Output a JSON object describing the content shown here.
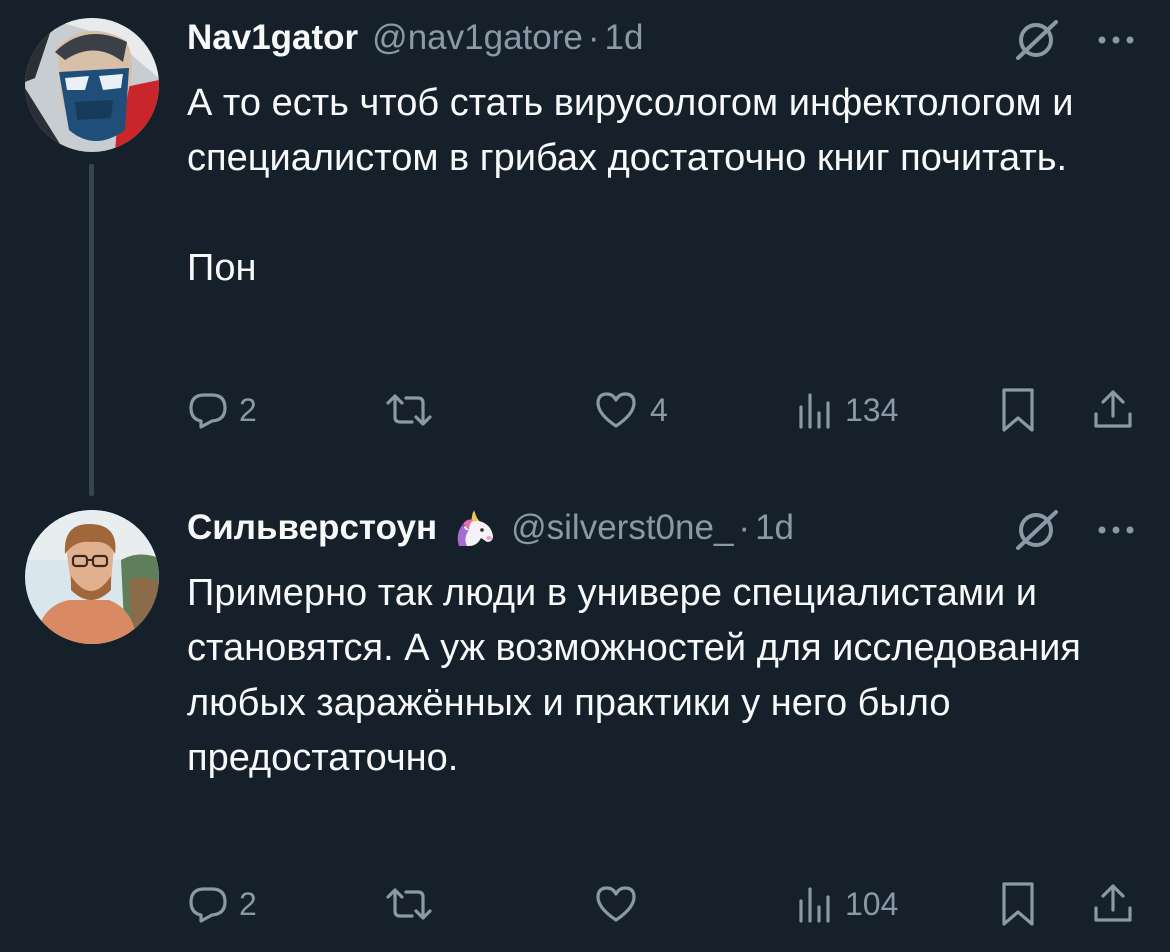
{
  "tweets": [
    {
      "display_name": "Nav1gator",
      "handle": "@nav1gatore",
      "separator": "·",
      "time": "1d",
      "avatar_icon": "masked-character-avatar",
      "body": [
        "А то есть чтоб стать вирусологом инфектологом и специалистом в грибах достаточно книг почитать.",
        "Пон"
      ],
      "replies": "2",
      "retweets": "",
      "likes": "4",
      "views": "134"
    },
    {
      "display_name": "Сильверстоун",
      "name_emoji": "unicorn-emoji",
      "handle": "@silverst0ne_",
      "separator": "·",
      "time": "1d",
      "avatar_icon": "bearded-man-photo-avatar",
      "body": [
        "Примерно так люди в универе специалистами и становятся. А уж возможностей для исследования любых заражённых и практики у него было предостаточно."
      ],
      "replies": "2",
      "retweets": "",
      "likes": "",
      "views": "104"
    }
  ],
  "colors": {
    "background": "#15202b",
    "text": "#f7f9f9",
    "secondary": "#8b98a5",
    "thread_line": "#38444d"
  }
}
